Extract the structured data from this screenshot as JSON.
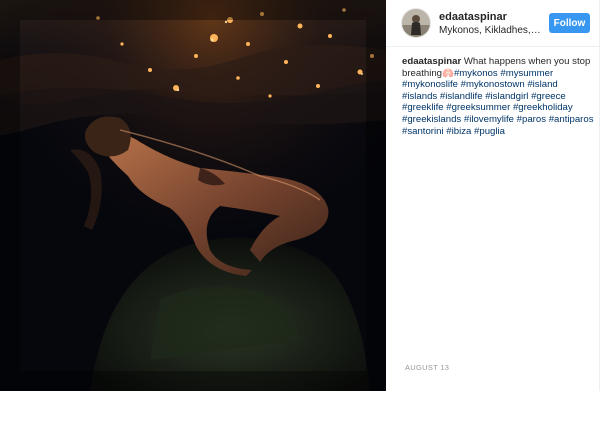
{
  "post": {
    "author": "edaataspinar",
    "location": "Mykonos, Kikladhes, Gr...",
    "follow_label": "Follow",
    "caption_text": "What happens when you stop breathing",
    "caption_emoji": "🫁",
    "hashtags": [
      "#mykonos",
      "#mysummer",
      "#mykonoslife",
      "#mykonostown",
      "#island",
      "#islands",
      "#islandlife",
      "#islandgirl",
      "#greece",
      "#greeklife",
      "#greeksummer",
      "#greekholiday",
      "#greekislands",
      "#ilovemylife",
      "#paros",
      "#antiparos",
      "#santorini",
      "#ibiza",
      "#puglia"
    ],
    "date": "AUGUST 13"
  },
  "photo": {
    "subject": "underwater swimmer with sunlit water surface",
    "icon": "photo-image"
  },
  "colors": {
    "follow_bg": "#3897f0",
    "hashtag": "#003569",
    "photo_bg": "#06070d"
  }
}
